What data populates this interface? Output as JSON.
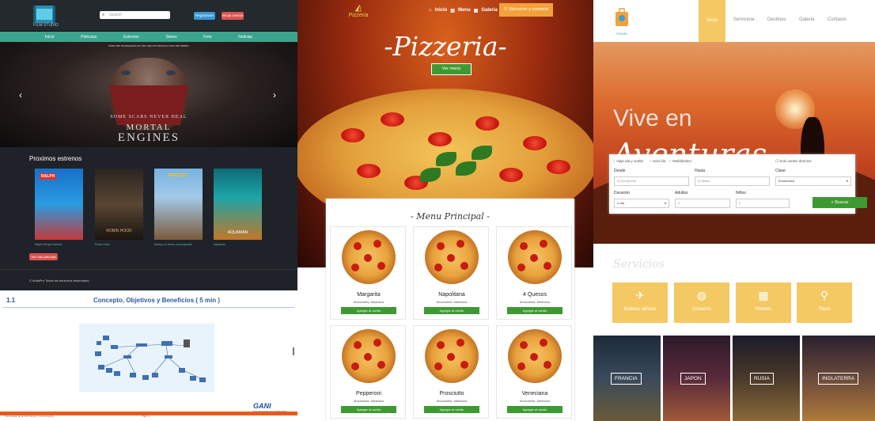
{
  "movie": {
    "logo_text": "FILM STUDIO",
    "search_placeholder": "Search",
    "register_label": "Registrarse",
    "login_label": "Iniciar Sesion",
    "nav": [
      "Inicio",
      "Peliculas",
      "Estrenos",
      "Series",
      "Free",
      "Noticias"
    ],
    "hero": {
      "tagline_small": "FROM THE FILMMAKERS OF THE LORD OF THE RINGS AND THE HOBBIT",
      "tagline": "SOME SCARS NEVER HEAL",
      "title1": "MORTAL",
      "title2": "ENGINES"
    },
    "section_title": "Proximos estrenos",
    "posters": [
      {
        "title": "Ralph Rompe Internet",
        "poster_text": "RALPH"
      },
      {
        "title": "Robin Hood",
        "poster_text": "ROBIN HOOD"
      },
      {
        "title": "Marley, un heroe muy especial",
        "poster_text": "MARLEY"
      },
      {
        "title": "Aquaman",
        "poster_text": "AQUAMAN"
      }
    ],
    "ver_mas_label": "Ver mas peliculas",
    "footer": "© AnilaPro Todos los derechos reservados."
  },
  "doc": {
    "number": "1.1",
    "title": "Concepto, Objetivos y Beneficios ( 5 min )",
    "brand": "GANI",
    "brand_sub": "SOLUCIONES EN SOFTWARE",
    "footer_left": "Tecnologías de la Información y Comunicación",
    "footer_mid": "Pág. 4"
  },
  "pizza": {
    "logo": "Pizzeria",
    "nav": [
      "Inicio",
      "Menu",
      "Galeria"
    ],
    "location_label": "Ubicacion y contacto",
    "title": "-Pizzeria-",
    "ver_menu": "Ver menú",
    "menu_title": "- Menu Principal -",
    "add_label": "Agregar al carrito",
    "items": [
      {
        "name": "Margarita",
        "desc": "Mozzarella, Albahaca"
      },
      {
        "name": "Napolitana",
        "desc": "Mozzarella, Albahaca"
      },
      {
        "name": "4 Quesos",
        "desc": "Mozzarella, Albahaca"
      },
      {
        "name": "Pepperoni",
        "desc": "Mozzarella, Albahaca"
      },
      {
        "name": "Prosciutto",
        "desc": "Mozzarella, Albahaca"
      },
      {
        "name": "Veneciana",
        "desc": "Mozzarella, Albahaca"
      }
    ]
  },
  "travel": {
    "logo": "TRAVEL",
    "nav": [
      "Inicio",
      "Servicios",
      "Destinos",
      "Galeria",
      "Contacto"
    ],
    "hero_l1": "Vive en",
    "hero_l2": "Aventuras",
    "radios": [
      "Viaje ida y vuelta",
      "Solo ida",
      "Multidestino",
      "Solo vuelos directos"
    ],
    "desde_label": "Desde",
    "desde_placeholder": "Ej Aeropuerto",
    "hasta_label": "Hasta",
    "hasta_placeholder": "Ej Miami",
    "clase_label": "Clase",
    "clase_value": "Económica",
    "duracion_label": "Duración",
    "duracion_value": "1 día",
    "adultos_label": "Adultos",
    "adultos_value": "0",
    "ninos_label": "Niños",
    "ninos_value": "0",
    "buscar_label": "Buscar",
    "servicios_title": "Servicios",
    "services": [
      "Boletos aéreos",
      "Cruceros",
      "Hoteles",
      "Tours"
    ],
    "destinations": [
      "FRANCIA",
      "JAPON",
      "RUSIA",
      "INGLATERRA"
    ]
  }
}
